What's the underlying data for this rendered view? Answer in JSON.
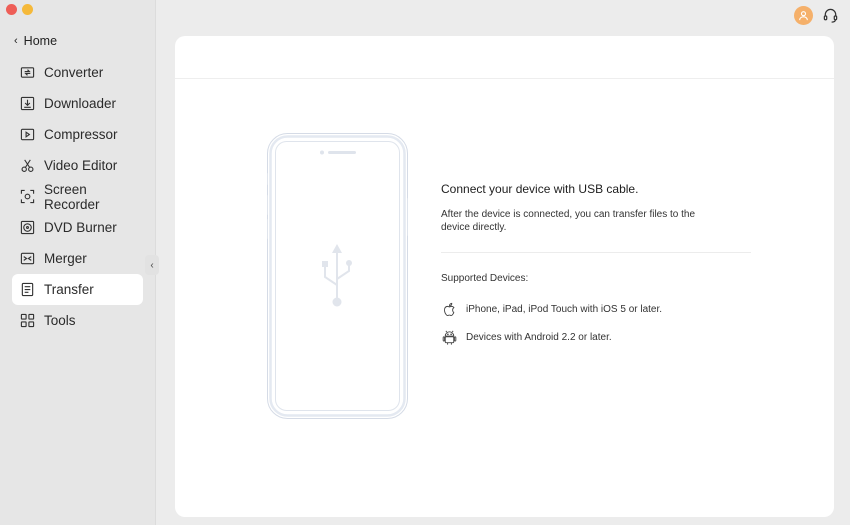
{
  "sidebar": {
    "home_label": "Home",
    "items": [
      {
        "label": "Converter",
        "icon": "converter-icon"
      },
      {
        "label": "Downloader",
        "icon": "downloader-icon"
      },
      {
        "label": "Compressor",
        "icon": "compressor-icon"
      },
      {
        "label": "Video Editor",
        "icon": "scissors-icon"
      },
      {
        "label": "Screen Recorder",
        "icon": "screen-recorder-icon"
      },
      {
        "label": "DVD Burner",
        "icon": "dvd-icon"
      },
      {
        "label": "Merger",
        "icon": "merger-icon"
      },
      {
        "label": "Transfer",
        "icon": "transfer-icon",
        "active": true
      },
      {
        "label": "Tools",
        "icon": "tools-icon"
      }
    ]
  },
  "transfer": {
    "heading": "Connect your device with USB cable.",
    "description": "After the device is connected, you can transfer files to the device directly.",
    "supported_label": "Supported Devices:",
    "devices": [
      {
        "label": "iPhone, iPad, iPod Touch with iOS 5 or later.",
        "icon": "apple-icon"
      },
      {
        "label": "Devices with Android 2.2 or later.",
        "icon": "android-icon"
      }
    ]
  },
  "colors": {
    "active_bg": "#ffffff",
    "sidebar_bg": "#e6e6e6",
    "avatar": "#f5b06a"
  }
}
